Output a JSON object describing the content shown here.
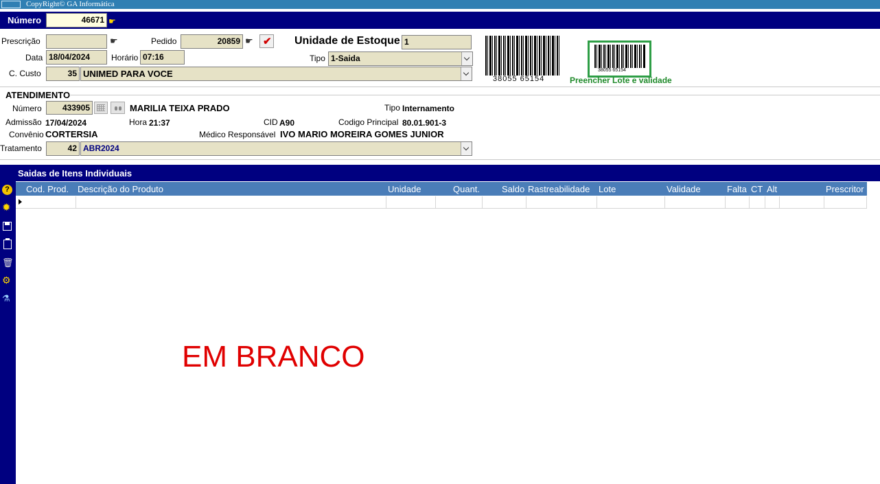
{
  "app": {
    "copyright": "CopyRight© GA Informática"
  },
  "header": {
    "numero_label": "Número",
    "numero_value": "46671"
  },
  "form": {
    "prescricao_label": "Prescrição",
    "prescricao_value": "",
    "pedido_label": "Pedido",
    "pedido_value": "20859",
    "unidade_estoque_label": "Unidade de Estoque",
    "unidade_estoque_value": "1",
    "data_label": "Data",
    "data_value": "18/04/2024",
    "horario_label": "Horário",
    "horario_value": "07:16",
    "tipo_label": "Tipo",
    "tipo_value": "1-Saida",
    "ccusto_label": "C. Custo",
    "ccusto_code": "35",
    "ccusto_value": "UNIMED PARA VOCE",
    "barcode_text": "38055 65154",
    "barcode_small_text": "38055 65154",
    "lote_link": "Preencher Lote e validade"
  },
  "atendimento": {
    "title": "ATENDIMENTO",
    "numero_label": "Número",
    "numero_value": "433905",
    "paciente": "MARILIA TEIXA PRADO",
    "tipo_label": "Tipo",
    "tipo_value": "Internamento",
    "admissao_label": "Admissão",
    "admissao_value": "17/04/2024",
    "hora_label": "Hora",
    "hora_value": "21:37",
    "cid_label": "CID",
    "cid_value": "A90",
    "codigo_label": "Codigo Principal",
    "codigo_value": "80.01.901-3",
    "convenio_label": "Convênio",
    "convenio_value": "CORTERSIA",
    "medico_label": "Médico Responsável",
    "medico_value": "IVO MARIO MOREIRA GOMES JUNIOR",
    "tratamento_label": "Tratamento",
    "tratamento_code": "42",
    "tratamento_value": "ABR2024"
  },
  "grid": {
    "title": "Saidas de Itens Individuais",
    "columns": [
      "Cod. Prod.",
      "Descrição do Produto",
      "Unidade",
      "Quant.",
      "Saldo",
      "Rastreabilidade",
      "Lote",
      "Validade",
      "Falta",
      "CT",
      "Alt",
      "Prescritor"
    ],
    "empty_text": "EM BRANCO"
  },
  "colors": {
    "navy": "#000080",
    "grid_header": "#4a7db8",
    "field_bg": "#e6e2c6",
    "link_green": "#1f8a2a",
    "empty_red": "#e00000"
  },
  "icons": [
    "help-icon",
    "new-icon",
    "save-icon",
    "clipboard-icon",
    "delete-icon",
    "settings-icon",
    "flask-icon",
    "calendar-icon",
    "binoculars-icon",
    "pointing-hand-icon",
    "checkmark-icon"
  ]
}
